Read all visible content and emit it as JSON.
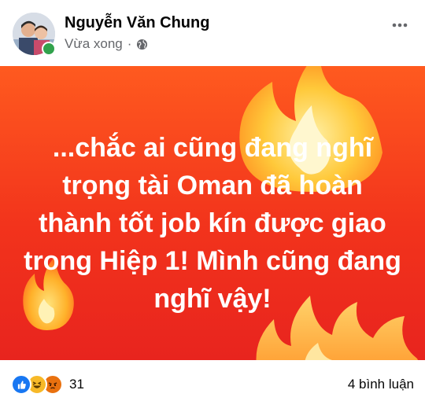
{
  "post": {
    "author_name": "Nguyễn Văn Chung",
    "timestamp": "Vừa xong",
    "separator": "·",
    "privacy_icon": "globe-icon",
    "more_icon": "more-options-icon",
    "text": "...chắc ai cũng đang nghĩ trọng tài Oman đã hoàn thành tốt job kín được giao trong Hiệp 1! Mình cũng đang nghĩ vậy!",
    "background_colors": [
      "#ff5a1f",
      "#e8241e"
    ]
  },
  "footer": {
    "reaction_icons": [
      "like-icon",
      "haha-icon",
      "angry-icon"
    ],
    "reaction_count": "31",
    "comments": "4 bình luận"
  },
  "colors": {
    "online": "#31a24c",
    "meta_text": "#65676b",
    "like_blue": "#1877f2",
    "haha_yellow": "#f7b928",
    "angry_orange": "#e9710f"
  }
}
